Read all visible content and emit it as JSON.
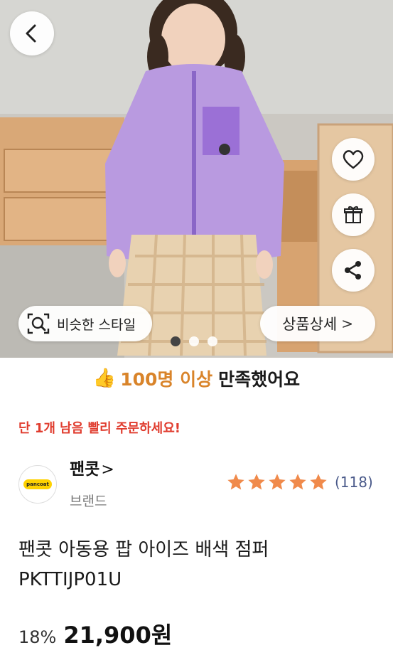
{
  "hero": {
    "similar_style_label": "비슷한 스타일",
    "detail_label": "상품상세",
    "detail_chevron": ">",
    "carousel": {
      "total": 3,
      "active": 0
    }
  },
  "satisfaction": {
    "thumb": "👍",
    "highlight": "100명 이상",
    "rest": "만족했어요"
  },
  "urgency_text": "단 1개 남음 빨리 주문하세요!",
  "brand": {
    "logo_text": "pancoat",
    "name": "팬콧",
    "chevron": ">",
    "subtitle": "브랜드",
    "rating_stars": 5,
    "review_count": "(118)",
    "star_color": "#f08a4b"
  },
  "product": {
    "title": "팬콧 아동용 팝 아이즈 배색 점퍼 PKTTIJP01U",
    "discount": "18%",
    "price": "21,900원"
  },
  "icons": [
    "back-arrow-icon",
    "heart-icon",
    "gift-icon",
    "share-icon",
    "image-search-icon",
    "thumbs-up-icon",
    "star-icon"
  ]
}
